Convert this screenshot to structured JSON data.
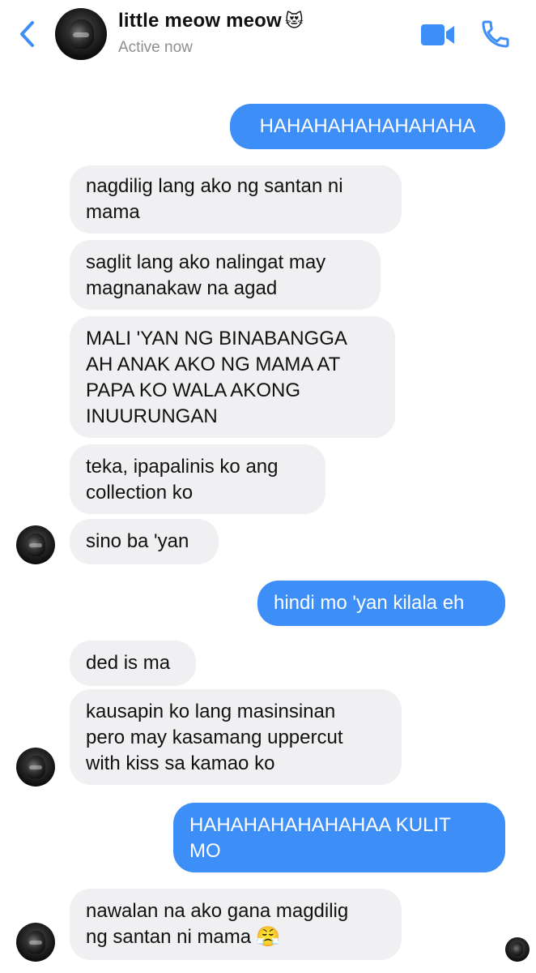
{
  "header": {
    "contact_name": "little meow meow",
    "name_emoji": "😻",
    "status": "Active now",
    "icons": {
      "back": "chevron-left-icon",
      "video": "video-camera-icon",
      "phone": "phone-icon"
    },
    "accent_color": "#3e8ef7"
  },
  "messages": [
    {
      "id": "m1",
      "direction": "outgoing",
      "lines": [
        "HAHAHAHAHAHAHAHA"
      ]
    },
    {
      "id": "m2",
      "direction": "incoming",
      "lines": [
        "nagdilig lang ako ng santan ni",
        "mama"
      ]
    },
    {
      "id": "m3",
      "direction": "incoming",
      "lines": [
        "saglit lang ako nalingat may",
        "magnanakaw na agad"
      ]
    },
    {
      "id": "m4",
      "direction": "incoming",
      "lines": [
        "MALI 'YAN NG BINABANGGA",
        "AH ANAK AKO NG MAMA AT",
        "PAPA KO WALA AKONG",
        "INUURUNGAN"
      ]
    },
    {
      "id": "m5",
      "direction": "incoming",
      "lines": [
        "teka, ipapalinis ko ang",
        "collection ko"
      ]
    },
    {
      "id": "m6",
      "direction": "incoming",
      "lines": [
        "sino ba 'yan"
      ]
    },
    {
      "id": "m7",
      "direction": "outgoing",
      "lines": [
        "hindi mo 'yan kilala eh"
      ]
    },
    {
      "id": "m8",
      "direction": "incoming",
      "lines": [
        "ded is ma"
      ]
    },
    {
      "id": "m9",
      "direction": "incoming",
      "lines": [
        "kausapin ko lang masinsinan",
        "pero may kasamang uppercut",
        "with kiss sa kamao ko"
      ]
    },
    {
      "id": "m10",
      "direction": "outgoing",
      "lines": [
        "HAHAHAHAHAHAHAA KULIT",
        "MO"
      ]
    },
    {
      "id": "m11",
      "direction": "incoming",
      "lines": [
        "nawalan na ako gana magdilig",
        "ng santan ni mama"
      ],
      "emoji": "😤"
    }
  ],
  "colors": {
    "incoming_bubble": "#f0f0f2",
    "outgoing_bubble": "#3e8ef7",
    "status_text": "#8e8e93"
  }
}
